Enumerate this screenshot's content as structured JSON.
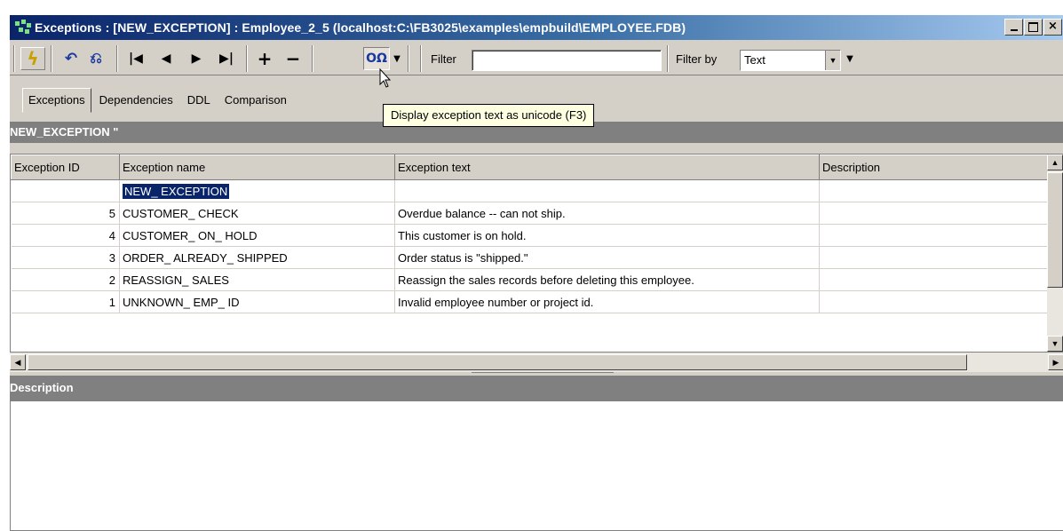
{
  "window": {
    "title": "Exceptions : [NEW_EXCEPTION] : Employee_2_5 (localhost:C:\\FB3025\\examples\\empbuild\\EMPLOYEE.FDB)"
  },
  "toolbar": {
    "compile_icon": "lightning-icon",
    "undo_icon": "undo-icon",
    "redo_icon": "redo-icon",
    "nav_icons": [
      "first-record-icon",
      "previous-record-icon",
      "next-record-icon",
      "last-record-icon"
    ],
    "unicode_button_text": "OΩ",
    "filter_label": "Filter",
    "filter_value": "",
    "filter_by_label": "Filter by",
    "filter_by_value": "Text"
  },
  "tabs": [
    "Exceptions",
    "Dependencies",
    "DDL",
    "Comparison"
  ],
  "tooltip": "Display exception text as unicode  (F3)",
  "grid": {
    "header": "NEW_EXCEPTION \"",
    "columns": [
      "Exception ID",
      "Exception name",
      "Exception text",
      "Description"
    ],
    "rows": [
      {
        "id": "",
        "name": "NEW_ EXCEPTION",
        "text": "",
        "description": ""
      },
      {
        "id": "5",
        "name": "CUSTOMER_ CHECK",
        "text": "Overdue balance -- can not ship.",
        "description": ""
      },
      {
        "id": "4",
        "name": "CUSTOMER_ ON_ HOLD",
        "text": "This customer is on hold.",
        "description": ""
      },
      {
        "id": "3",
        "name": "ORDER_ ALREADY_ SHIPPED",
        "text": "Order status is \"shipped.\"",
        "description": ""
      },
      {
        "id": "2",
        "name": "REASSIGN_ SALES",
        "text": "Reassign the sales records before deleting this employee.",
        "description": ""
      },
      {
        "id": "1",
        "name": "UNKNOWN_ EMP_ ID",
        "text": "Invalid employee number or project id.",
        "description": ""
      }
    ]
  },
  "description_panel": {
    "header": "Description",
    "value": ""
  },
  "colors": {
    "title_gradient_start": "#0a246a",
    "title_gradient_end": "#a6caf0",
    "selection": "#0a246a",
    "panel_header": "#808080"
  }
}
